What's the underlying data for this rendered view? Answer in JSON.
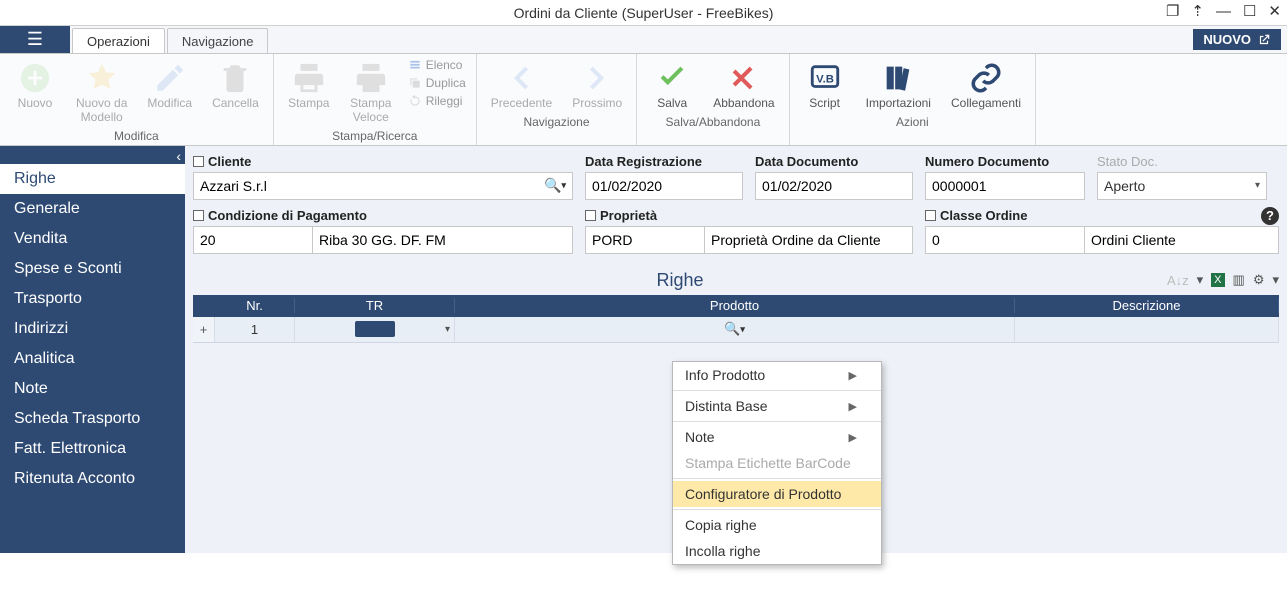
{
  "title": "Ordini da Cliente (SuperUser - FreeBikes)",
  "tabs": {
    "op": "Operazioni",
    "nav": "Navigazione"
  },
  "nuovo_btn": "NUOVO",
  "ribbon": {
    "nuovo": "Nuovo",
    "nuovo_da_modello": "Nuovo da\nModello",
    "modifica": "Modifica",
    "cancella": "Cancella",
    "grp_modifica": "Modifica",
    "stampa": "Stampa",
    "stampa_veloce": "Stampa\nVeloce",
    "elenco": "Elenco",
    "duplica": "Duplica",
    "rileggi": "Rileggi",
    "grp_stampa": "Stampa/Ricerca",
    "precedente": "Precedente",
    "prossimo": "Prossimo",
    "grp_nav": "Navigazione",
    "salva": "Salva",
    "abbandona": "Abbandona",
    "grp_salva": "Salva/Abbandona",
    "script": "Script",
    "importazioni": "Importazioni",
    "collegamenti": "Collegamenti",
    "grp_azioni": "Azioni"
  },
  "sidebar": {
    "items": [
      "Righe",
      "Generale",
      "Vendita",
      "Spese e Sconti",
      "Trasporto",
      "Indirizzi",
      "Analitica",
      "Note",
      "Scheda Trasporto",
      "Fatt. Elettronica",
      "Ritenuta Acconto"
    ]
  },
  "form": {
    "cliente_label": "Cliente",
    "cliente_value": "Azzari S.r.l",
    "data_reg_label": "Data Registrazione",
    "data_reg_value": "01/02/2020",
    "data_doc_label": "Data Documento",
    "data_doc_value": "01/02/2020",
    "num_doc_label": "Numero Documento",
    "num_doc_value": "0000001",
    "stato_label": "Stato Doc.",
    "stato_value": "Aperto",
    "cond_pag_label": "Condizione di Pagamento",
    "cond_pag_code": "20",
    "cond_pag_desc": "Riba 30 GG. DF. FM",
    "proprieta_label": "Proprietà",
    "proprieta_code": "PORD",
    "proprieta_desc": "Proprietà Ordine da Cliente",
    "classe_label": "Classe Ordine",
    "classe_code": "0",
    "classe_desc": "Ordini Cliente"
  },
  "grid": {
    "title": "Righe",
    "cols": {
      "nr": "Nr.",
      "tr": "TR",
      "prodotto": "Prodotto",
      "descrizione": "Descrizione"
    },
    "row1_nr": "1"
  },
  "ctx": {
    "info_prodotto": "Info Prodotto",
    "distinta_base": "Distinta Base",
    "note": "Note",
    "stampa_barcode": "Stampa Etichette BarCode",
    "configuratore": "Configuratore di Prodotto",
    "copia_righe": "Copia righe",
    "incolla_righe": "Incolla righe"
  }
}
